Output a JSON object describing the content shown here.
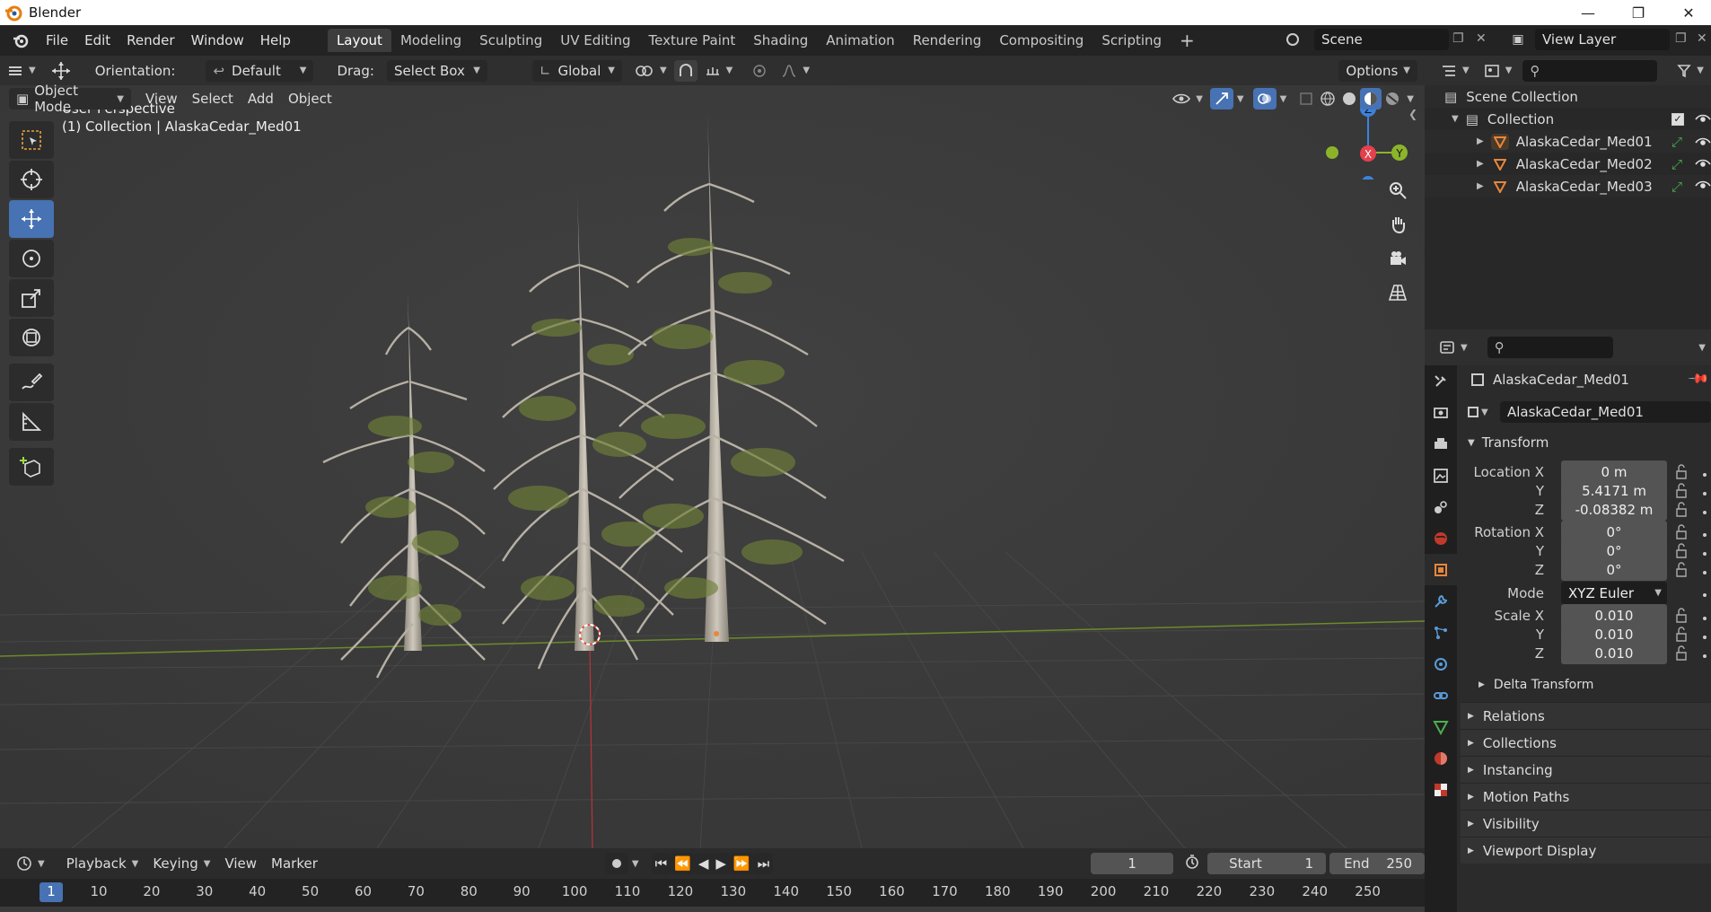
{
  "window": {
    "title": "Blender"
  },
  "menu": [
    "File",
    "Edit",
    "Render",
    "Window",
    "Help"
  ],
  "workspaces": [
    "Layout",
    "Modeling",
    "Sculpting",
    "UV Editing",
    "Texture Paint",
    "Shading",
    "Animation",
    "Rendering",
    "Compositing",
    "Scripting"
  ],
  "active_workspace": "Layout",
  "scene": {
    "name": "Scene",
    "view_layer": "View Layer"
  },
  "tool_header": {
    "orientation_label": "Orientation:",
    "orientation_value": "Default",
    "drag_label": "Drag:",
    "drag_value": "Select Box",
    "transform_space": "Global",
    "options": "Options"
  },
  "viewport_header": {
    "mode": "Object Mode",
    "menus": [
      "View",
      "Select",
      "Add",
      "Object"
    ]
  },
  "viewport": {
    "perspective": "User Perspective",
    "context": "(1) Collection | AlaskaCedar_Med01"
  },
  "gizmo": {
    "x": "X",
    "y": "Y",
    "z": "Z"
  },
  "timeline": {
    "menus": [
      "Playback",
      "Keying",
      "View",
      "Marker"
    ],
    "current_frame": "1",
    "start_label": "Start",
    "start": "1",
    "end_label": "End",
    "end": "250",
    "ticks": [
      "1",
      "10",
      "20",
      "30",
      "40",
      "50",
      "60",
      "70",
      "80",
      "90",
      "100",
      "110",
      "120",
      "130",
      "140",
      "150",
      "160",
      "170",
      "180",
      "190",
      "200",
      "210",
      "220",
      "230",
      "240",
      "250"
    ]
  },
  "outliner": {
    "root": "Scene Collection",
    "collection": "Collection",
    "objects": [
      "AlaskaCedar_Med01",
      "AlaskaCedar_Med02",
      "AlaskaCedar_Med03"
    ]
  },
  "properties": {
    "object_name": "AlaskaCedar_Med01",
    "data_name": "AlaskaCedar_Med01",
    "transform_title": "Transform",
    "location_label": "Location X",
    "location": [
      "0 m",
      "5.4171 m",
      "-0.08382 m"
    ],
    "rotation_label": "Rotation X",
    "rotation": [
      "0°",
      "0°",
      "0°"
    ],
    "mode_label": "Mode",
    "mode_value": "XYZ Euler",
    "scale_label": "Scale X",
    "scale": [
      "0.010",
      "0.010",
      "0.010"
    ],
    "axis_y": "Y",
    "axis_z": "Z",
    "delta": "Delta Transform",
    "sections": [
      "Relations",
      "Collections",
      "Instancing",
      "Motion Paths",
      "Visibility",
      "Viewport Display"
    ]
  },
  "colors": {
    "accent": "#4772b3",
    "x_axis": "#e6404d",
    "y_axis": "#8cb42b",
    "z_axis": "#3c82dc",
    "object_orange": "#e8873a"
  }
}
